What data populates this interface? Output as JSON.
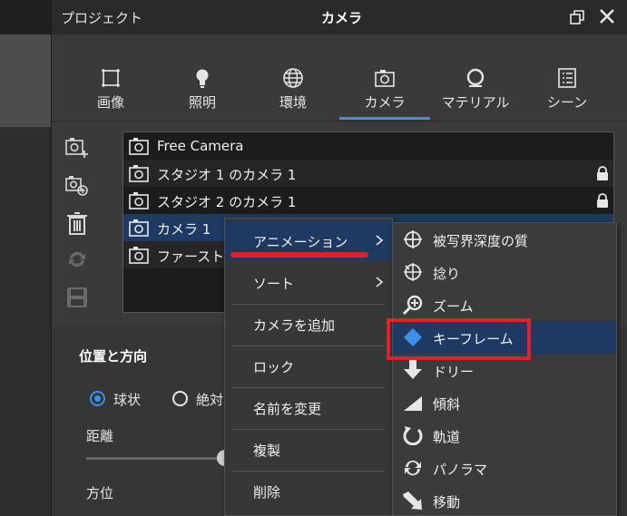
{
  "window": {
    "project_label": "プロジェクト",
    "title": "カメラ"
  },
  "tabs": [
    {
      "label": "画像",
      "icon": "image-frame-icon"
    },
    {
      "label": "照明",
      "icon": "lightbulb-icon"
    },
    {
      "label": "環境",
      "icon": "globe-icon"
    },
    {
      "label": "カメラ",
      "icon": "camera-icon",
      "active": true
    },
    {
      "label": "マテリアル",
      "icon": "material-sphere-icon"
    },
    {
      "label": "シーン",
      "icon": "scene-list-icon"
    }
  ],
  "side_tools": [
    "add-camera-icon",
    "duplicate-camera-icon",
    "delete-icon",
    "sync-icon",
    "save-icon"
  ],
  "camera_list": [
    {
      "label": "Free Camera",
      "locked": false
    },
    {
      "label": "スタジオ 1 のカメラ 1",
      "locked": true
    },
    {
      "label": "スタジオ 2 のカメラ 1",
      "locked": true
    },
    {
      "label": "カメラ 1",
      "locked": false,
      "selected": true
    },
    {
      "label": "ファーストパ",
      "locked": false
    }
  ],
  "section": {
    "title": "位置と方向",
    "radio_spherical": "球状",
    "radio_absolute": "絶対",
    "distance_label": "距離",
    "azimuth_label": "方位"
  },
  "context_menu": [
    {
      "label": "アニメーション",
      "submenu": true,
      "highlighted": true
    },
    {
      "label": "ソート",
      "submenu": true
    },
    {
      "label": "カメラを追加"
    },
    {
      "label": "ロック"
    },
    {
      "label": "名前を変更"
    },
    {
      "label": "複製"
    },
    {
      "label": "削除"
    }
  ],
  "animation_submenu": [
    {
      "label": "被写界深度の質",
      "icon": "crosshair-icon"
    },
    {
      "label": "捻り",
      "icon": "twist-icon"
    },
    {
      "label": "ズーム",
      "icon": "zoom-icon"
    },
    {
      "label": "キーフレーム",
      "icon": "keyframe-diamond-icon",
      "highlighted": true
    },
    {
      "label": "ドリー",
      "icon": "dolly-arrow-icon"
    },
    {
      "label": "傾斜",
      "icon": "tilt-icon"
    },
    {
      "label": "軌道",
      "icon": "orbit-icon"
    },
    {
      "label": "パノラマ",
      "icon": "panorama-icon"
    },
    {
      "label": "移動",
      "icon": "move-arrow-icon"
    }
  ],
  "colors": {
    "accent": "#3d8fe8",
    "highlight": "#1e3a62",
    "annotation_red": "#e0202c",
    "keyframe_blue": "#3d8fe8"
  }
}
